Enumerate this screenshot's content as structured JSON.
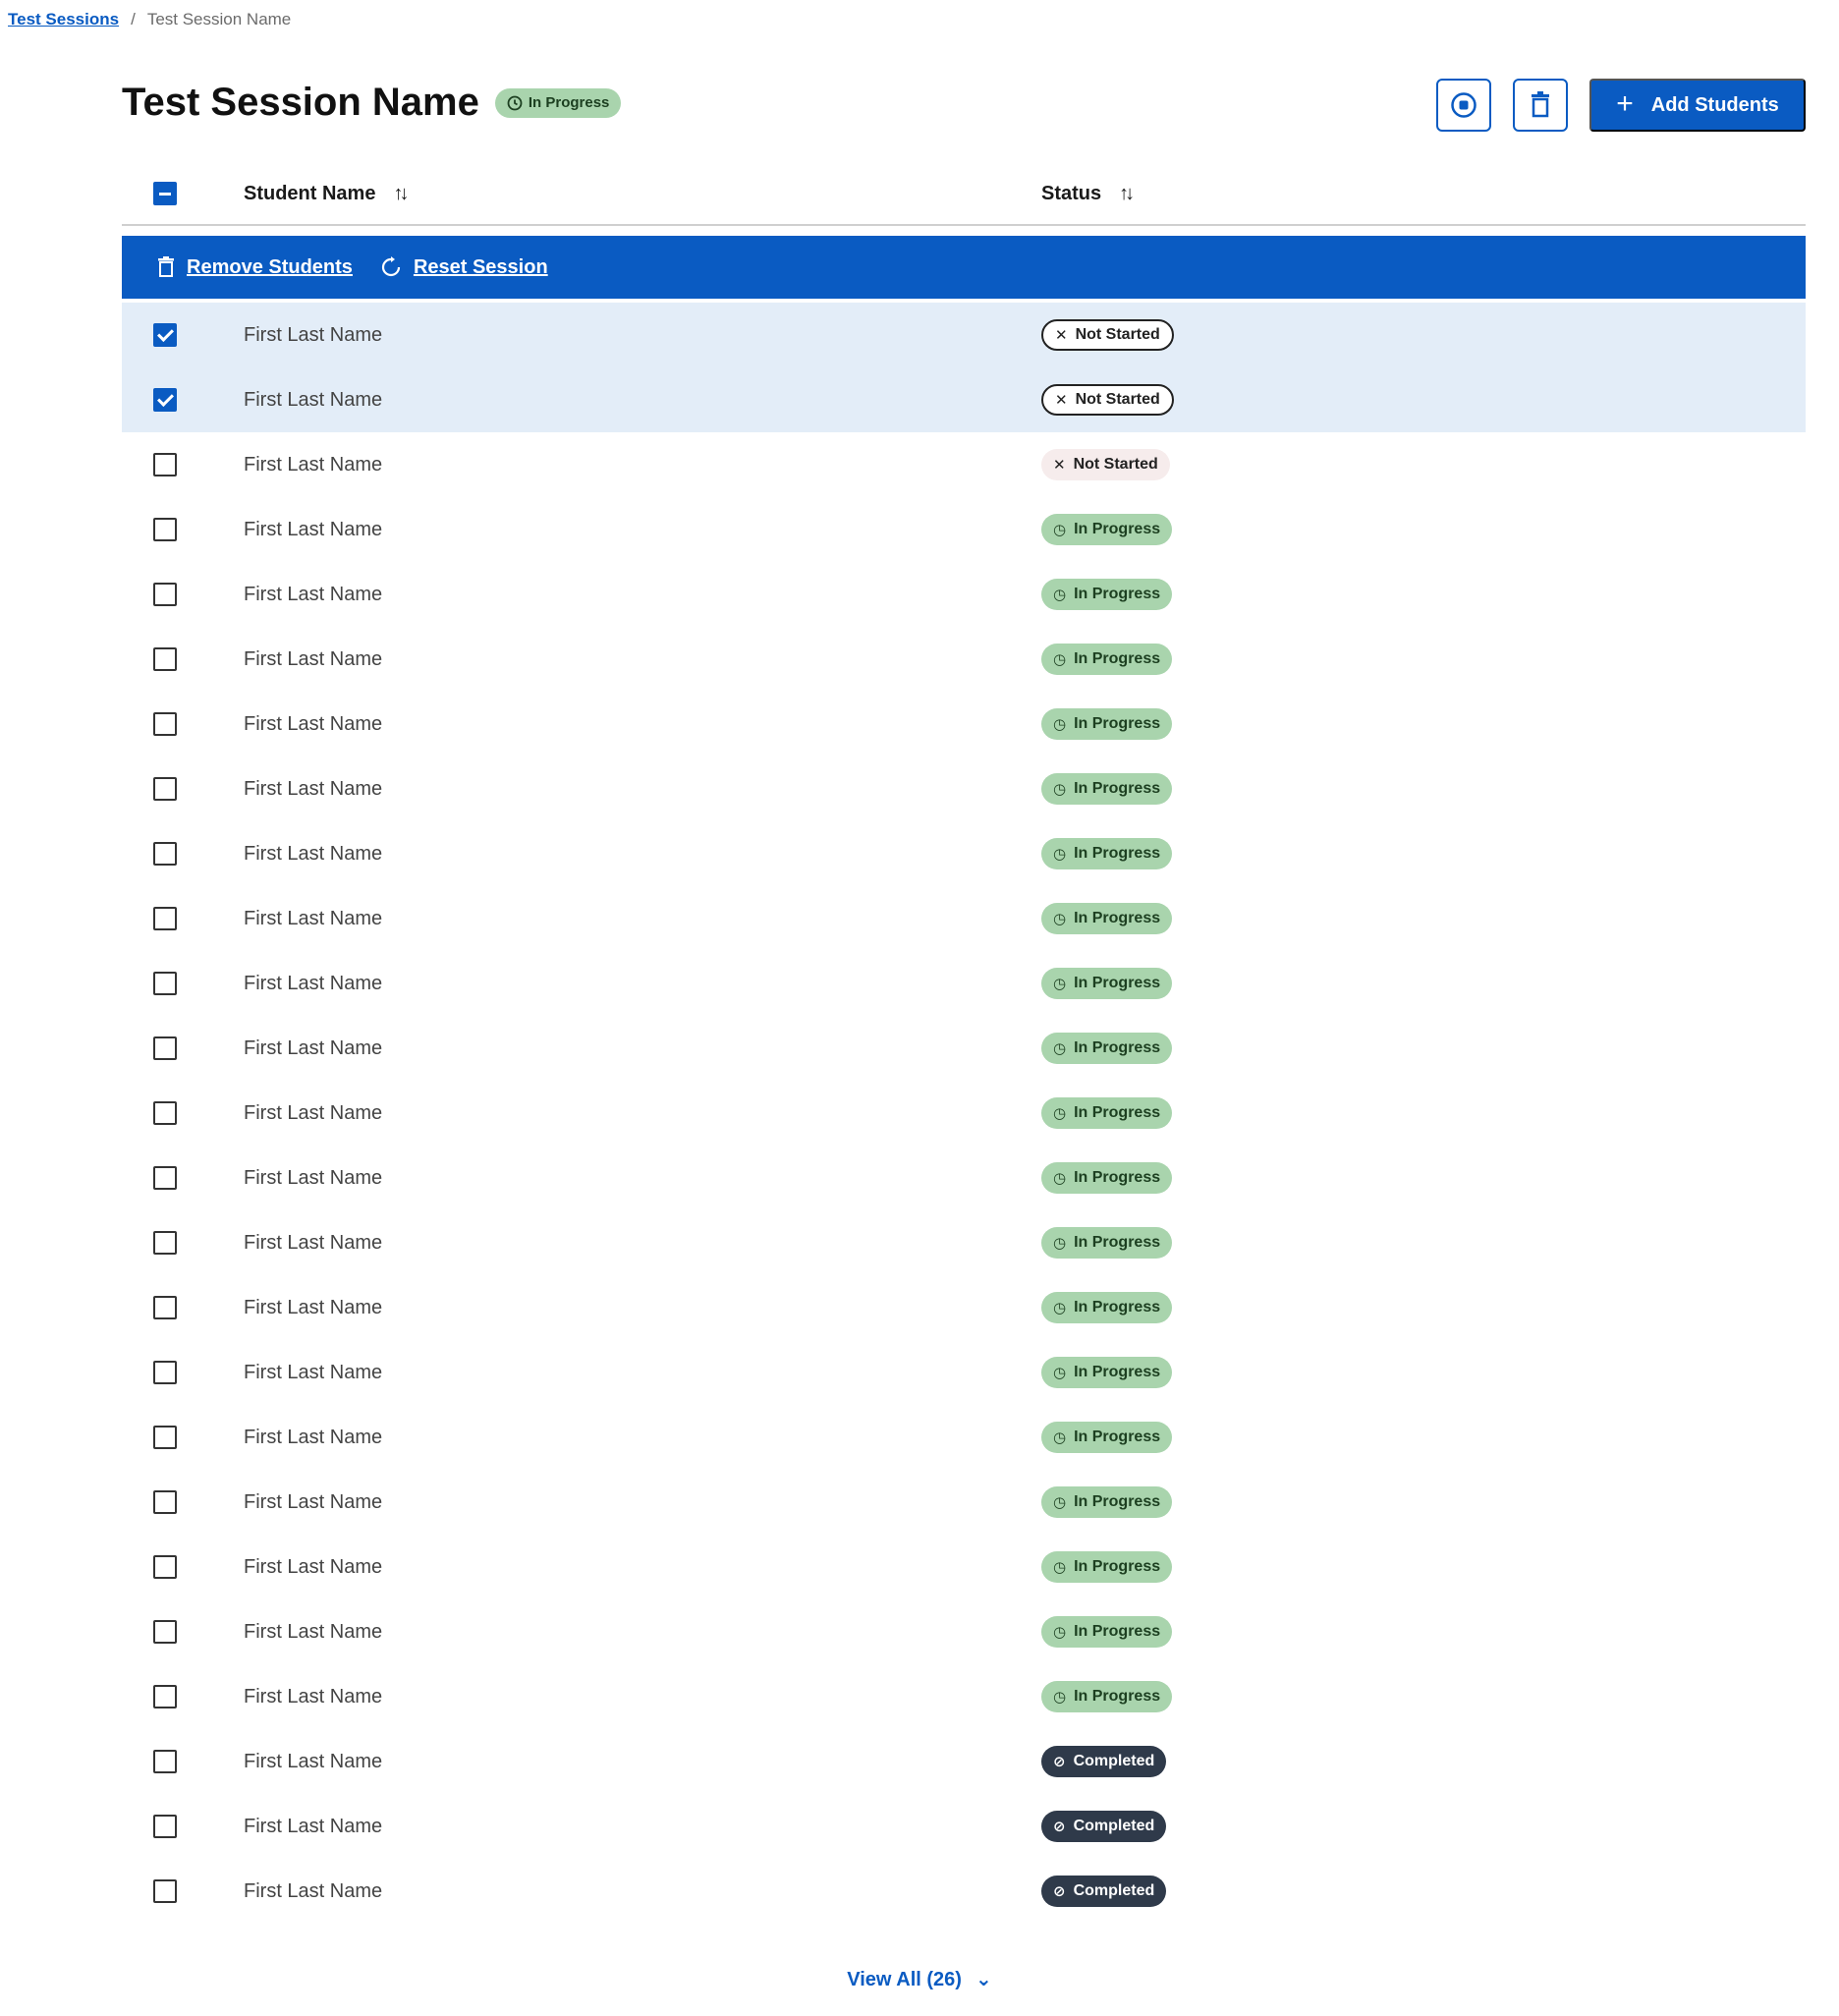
{
  "breadcrumb": {
    "root": "Test Sessions",
    "separator": "/",
    "current": "Test Session Name"
  },
  "header": {
    "title": "Test Session Name",
    "status_badge": "In Progress",
    "stop_icon": "stop-circle-icon",
    "delete_icon": "trash-icon",
    "add_students_label": "Add Students"
  },
  "table": {
    "columns": [
      "Student Name",
      "Status"
    ],
    "bulk_actions": {
      "remove_label": "Remove Students",
      "reset_label": "Reset Session"
    },
    "rows": [
      {
        "name": "First Last Name",
        "status": "Not Started",
        "selected": true
      },
      {
        "name": "First Last Name",
        "status": "Not Started",
        "selected": true
      },
      {
        "name": "First Last Name",
        "status": "Not Started",
        "selected": false
      },
      {
        "name": "First Last Name",
        "status": "In Progress",
        "selected": false
      },
      {
        "name": "First Last Name",
        "status": "In Progress",
        "selected": false
      },
      {
        "name": "First Last Name",
        "status": "In Progress",
        "selected": false
      },
      {
        "name": "First Last Name",
        "status": "In Progress",
        "selected": false
      },
      {
        "name": "First Last Name",
        "status": "In Progress",
        "selected": false
      },
      {
        "name": "First Last Name",
        "status": "In Progress",
        "selected": false
      },
      {
        "name": "First Last Name",
        "status": "In Progress",
        "selected": false
      },
      {
        "name": "First Last Name",
        "status": "In Progress",
        "selected": false
      },
      {
        "name": "First Last Name",
        "status": "In Progress",
        "selected": false
      },
      {
        "name": "First Last Name",
        "status": "In Progress",
        "selected": false
      },
      {
        "name": "First Last Name",
        "status": "In Progress",
        "selected": false
      },
      {
        "name": "First Last Name",
        "status": "In Progress",
        "selected": false
      },
      {
        "name": "First Last Name",
        "status": "In Progress",
        "selected": false
      },
      {
        "name": "First Last Name",
        "status": "In Progress",
        "selected": false
      },
      {
        "name": "First Last Name",
        "status": "In Progress",
        "selected": false
      },
      {
        "name": "First Last Name",
        "status": "In Progress",
        "selected": false
      },
      {
        "name": "First Last Name",
        "status": "In Progress",
        "selected": false
      },
      {
        "name": "First Last Name",
        "status": "In Progress",
        "selected": false
      },
      {
        "name": "First Last Name",
        "status": "In Progress",
        "selected": false
      },
      {
        "name": "First Last Name",
        "status": "Completed",
        "selected": false
      },
      {
        "name": "First Last Name",
        "status": "Completed",
        "selected": false
      },
      {
        "name": "First Last Name",
        "status": "Completed",
        "selected": false
      }
    ]
  },
  "footer": {
    "view_all_label": "View All (26)"
  },
  "colors": {
    "primary": "#0a5bc2",
    "in_progress_bg": "#a9d4ad",
    "completed_bg": "#2f3a4a",
    "selected_row_bg": "#e3edf8"
  }
}
